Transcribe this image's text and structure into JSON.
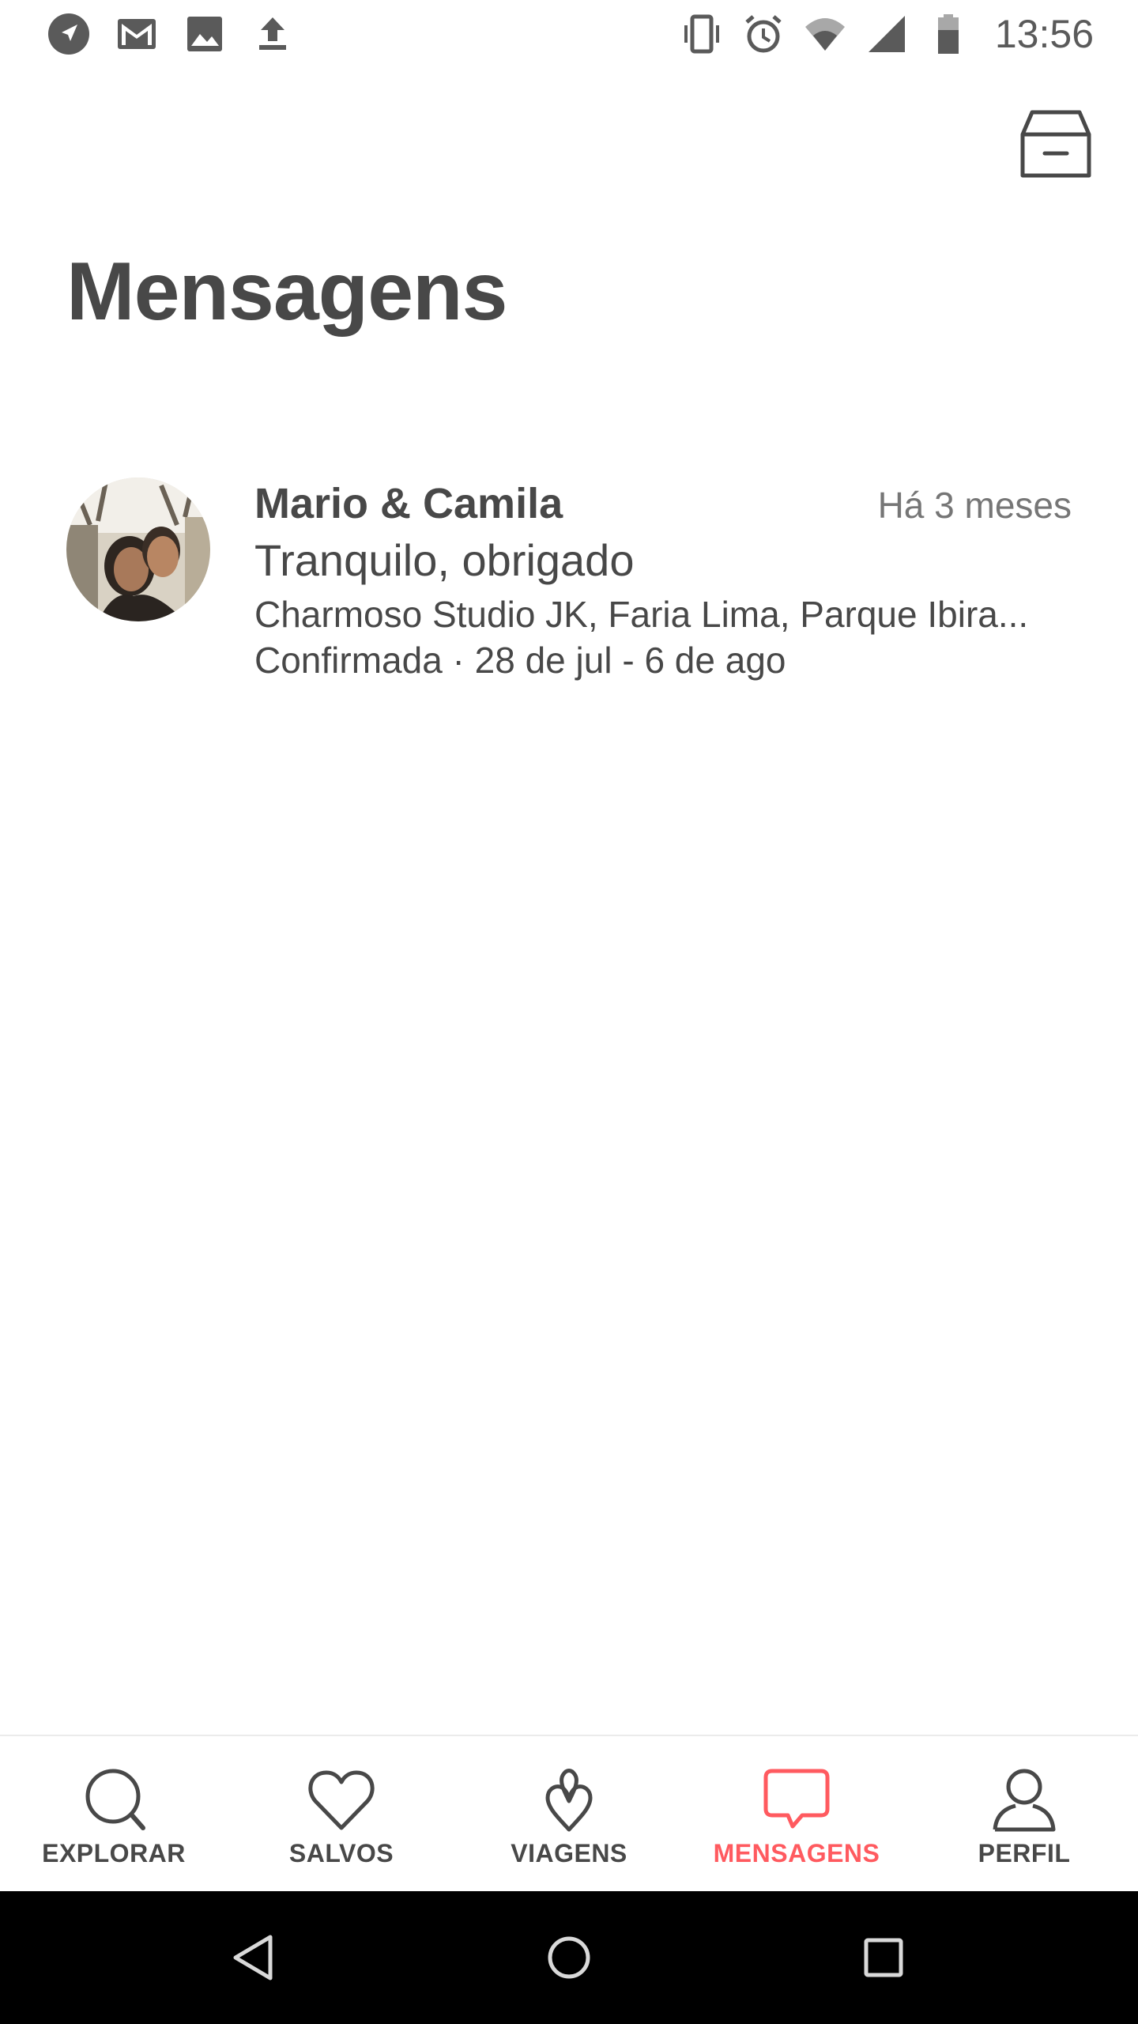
{
  "status_bar": {
    "time": "13:56",
    "left_icons": [
      "navigation-icon",
      "gmail-icon",
      "image-icon",
      "upload-icon"
    ],
    "right_icons": [
      "vibrate-icon",
      "alarm-icon",
      "wifi-icon",
      "signal-icon",
      "battery-icon"
    ]
  },
  "header": {
    "archive_icon": "archive-icon",
    "title": "Mensagens"
  },
  "threads": [
    {
      "name": "Mario & Camila",
      "time": "Há 3 meses",
      "last_message": "Tranquilo, obrigado",
      "listing": "Charmoso Studio JK, Faria Lima, Parque Ibira...",
      "status": "Confirmada · 28 de jul - 6 de ago"
    }
  ],
  "tabs": [
    {
      "label": "EXPLORAR",
      "icon": "search-icon",
      "active": false
    },
    {
      "label": "SALVOS",
      "icon": "heart-icon",
      "active": false
    },
    {
      "label": "VIAGENS",
      "icon": "airbnb-logo-icon",
      "active": false
    },
    {
      "label": "MENSAGENS",
      "icon": "message-icon",
      "active": true
    },
    {
      "label": "PERFIL",
      "icon": "profile-icon",
      "active": false
    }
  ],
  "colors": {
    "accent": "#ff5a5f",
    "text": "#484848",
    "muted": "#767676"
  },
  "nav_bar": {
    "buttons": [
      "back-icon",
      "home-icon",
      "recents-icon"
    ]
  }
}
